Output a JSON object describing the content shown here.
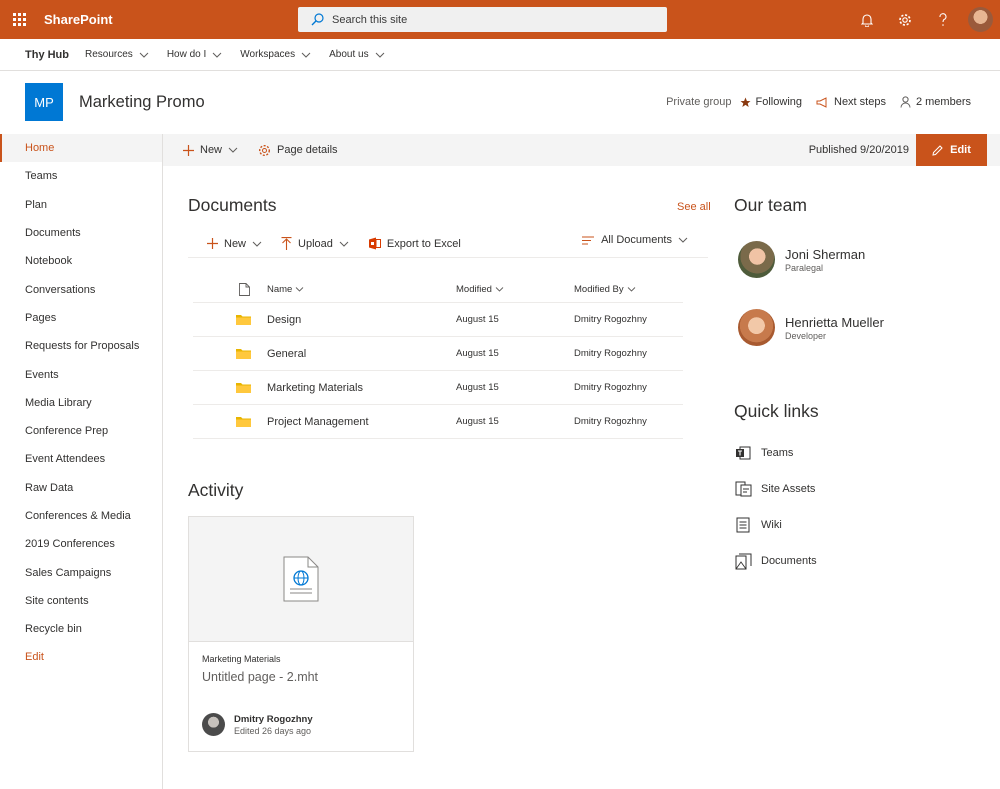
{
  "suite": {
    "app_name": "SharePoint",
    "search_placeholder": "Search this site"
  },
  "hub": {
    "name": "Thy Hub",
    "items": [
      {
        "label": "Resources"
      },
      {
        "label": "How do I"
      },
      {
        "label": "Workspaces"
      },
      {
        "label": "About us"
      }
    ]
  },
  "site": {
    "logo_initials": "MP",
    "title": "Marketing Promo",
    "privacy": "Private group",
    "following_label": "Following",
    "next_steps_label": "Next steps",
    "members_label": "2 members"
  },
  "leftnav": {
    "items": [
      {
        "label": "Home"
      },
      {
        "label": "Teams"
      },
      {
        "label": "Plan"
      },
      {
        "label": "Documents"
      },
      {
        "label": "Notebook"
      },
      {
        "label": "Conversations"
      },
      {
        "label": "Pages"
      },
      {
        "label": "Requests for Proposals"
      },
      {
        "label": "Events"
      },
      {
        "label": "Media Library"
      },
      {
        "label": "Conference Prep"
      },
      {
        "label": "Event Attendees"
      },
      {
        "label": "Raw Data"
      },
      {
        "label": "Conferences & Media"
      },
      {
        "label": "2019 Conferences"
      },
      {
        "label": "Sales Campaigns"
      },
      {
        "label": "Site contents"
      },
      {
        "label": "Recycle bin"
      }
    ],
    "edit_label": "Edit"
  },
  "commandbar": {
    "new_label": "New",
    "page_details_label": "Page details",
    "published": "Published 9/20/2019",
    "edit_label": "Edit"
  },
  "documents": {
    "title": "Documents",
    "see_all": "See all",
    "new_label": "New",
    "upload_label": "Upload",
    "export_label": "Export to Excel",
    "view_label": "All Documents",
    "columns": {
      "name": "Name",
      "modified": "Modified",
      "modified_by": "Modified By"
    },
    "rows": [
      {
        "name": "Design",
        "modified": "August 15",
        "modified_by": "Dmitry Rogozhny"
      },
      {
        "name": "General",
        "modified": "August 15",
        "modified_by": "Dmitry Rogozhny"
      },
      {
        "name": "Marketing Materials",
        "modified": "August 15",
        "modified_by": "Dmitry Rogozhny"
      },
      {
        "name": "Project Management",
        "modified": "August 15",
        "modified_by": "Dmitry Rogozhny"
      }
    ]
  },
  "activity": {
    "title": "Activity",
    "card": {
      "library": "Marketing Materials",
      "file": "Untitled page - 2.mht",
      "person": "Dmitry Rogozhny",
      "when": "Edited 26 days ago"
    }
  },
  "team": {
    "title": "Our team",
    "members": [
      {
        "name": "Joni Sherman",
        "role": "Paralegal"
      },
      {
        "name": "Henrietta Mueller",
        "role": "Developer"
      }
    ]
  },
  "quicklinks": {
    "title": "Quick links",
    "items": [
      {
        "label": "Teams",
        "icon": "teams-icon"
      },
      {
        "label": "Site Assets",
        "icon": "site-assets-icon"
      },
      {
        "label": "Wiki",
        "icon": "wiki-icon"
      },
      {
        "label": "Documents",
        "icon": "documents-icon"
      }
    ]
  },
  "colors": {
    "accent": "#c9531b",
    "logo": "#0078d4"
  }
}
